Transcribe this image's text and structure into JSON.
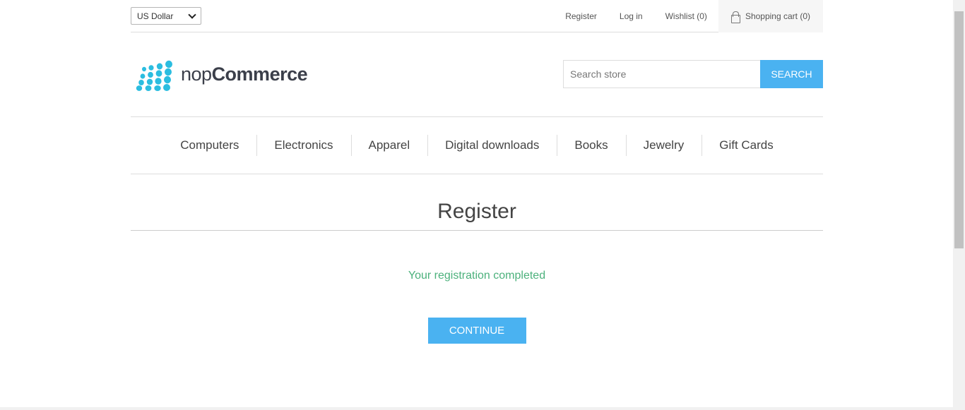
{
  "header": {
    "currency": "US Dollar",
    "links": {
      "register": "Register",
      "login": "Log in",
      "wishlist": "Wishlist (0)",
      "cart": "Shopping cart (0)"
    },
    "cart_icon": "shopping-bag-icon"
  },
  "logo": {
    "icon": "nopcommerce-dots-logo",
    "text_light": "nop",
    "text_bold": "Commerce",
    "color": "#2bbde0"
  },
  "search": {
    "placeholder": "Search store",
    "button_label": "SEARCH"
  },
  "nav": {
    "items": [
      "Computers",
      "Electronics",
      "Apparel",
      "Digital downloads",
      "Books",
      "Jewelry",
      "Gift Cards"
    ]
  },
  "main": {
    "title": "Register",
    "result_message": "Your registration completed",
    "continue_label": "CONTINUE"
  },
  "colors": {
    "accent": "#4ab2f1",
    "success": "#4cb17c"
  }
}
